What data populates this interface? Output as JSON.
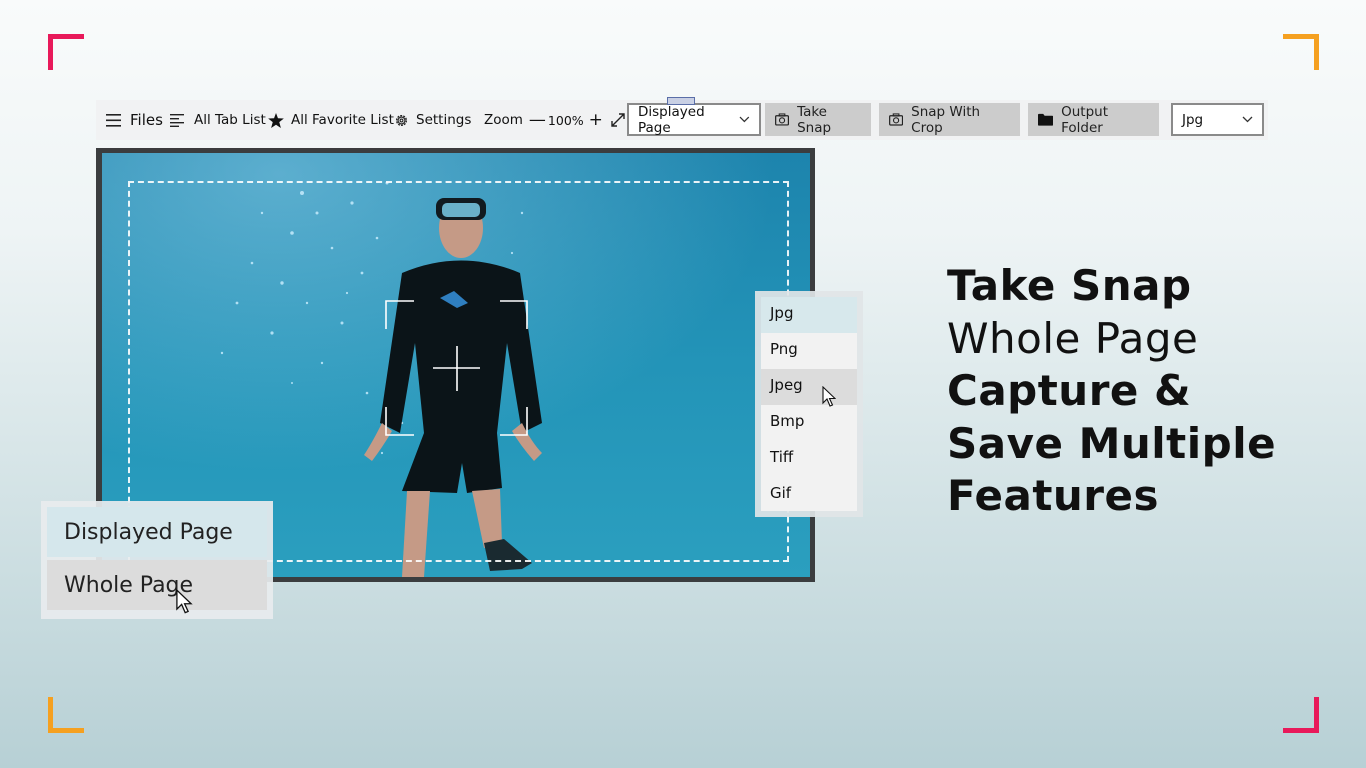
{
  "toolbar": {
    "files": "Files",
    "all_tab_list": "All Tab List",
    "all_favorite_list": "All Favorite List",
    "settings": "Settings",
    "zoom_label": "Zoom",
    "zoom_minus": "—",
    "zoom_value": "100%",
    "zoom_plus": "+",
    "capture_mode_selected": "Displayed Page",
    "take_snap": "Take Snap",
    "snap_with_crop": "Snap With Crop",
    "output_folder": "Output Folder",
    "format_selected": "Jpg"
  },
  "format_list": {
    "options": [
      "Jpg",
      "Png",
      "Jpeg",
      "Bmp",
      "Tiff",
      "Gif"
    ],
    "selected": "Jpg",
    "hovered": "Jpeg"
  },
  "mode_list": {
    "options": [
      "Displayed Page",
      "Whole Page"
    ],
    "selected": "Displayed Page",
    "hovered": "Whole Page"
  },
  "headline": {
    "line1": "Take Snap",
    "line2": "Whole Page",
    "line3": "Capture &",
    "line4": "Save Multiple",
    "line5": "Features"
  },
  "colors": {
    "corner_pink": "#e8195a",
    "corner_orange": "#f5a020",
    "toolbar_bg": "#f1f2f3",
    "button_bg": "#cccccc",
    "selected_bg": "#d7e8ec",
    "water": "#1f8fb4"
  },
  "icons": {
    "files": "hamburger-icon",
    "tab_list": "list-icon",
    "favorite": "star-icon",
    "settings": "gear-icon",
    "expand": "expand-icon",
    "camera": "camera-icon",
    "folder": "folder-icon",
    "dropdown": "chevron-down-icon"
  }
}
